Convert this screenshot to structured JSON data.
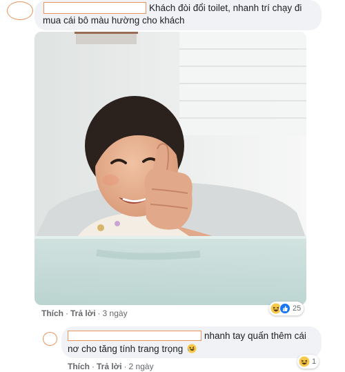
{
  "comment1": {
    "text_line1": "Khách đòi đổi toilet, nhanh trí chạy đi",
    "text_line2": "mua cái bô màu hường cho khách",
    "actions": {
      "like": "Thích",
      "reply": "Trả lời",
      "time": "3 ngày"
    },
    "reactions": {
      "icons": [
        "haha-icon",
        "like-icon"
      ],
      "count": "25"
    }
  },
  "comment2": {
    "text_line1": "nhanh tay quấn thêm cái",
    "text_line2": "nơ cho tăng tính trang trọng",
    "emoji": "rofl-emoji",
    "actions": {
      "like": "Thích",
      "reply": "Trả lời",
      "time": "2 ngày"
    },
    "reactions": {
      "icons": [
        "haha-icon"
      ],
      "count": "1"
    }
  },
  "colors": {
    "bubble": "#f0f2f5",
    "redaction": "#e8935a",
    "meta": "#65676b",
    "like_blue": "#1877f2"
  }
}
